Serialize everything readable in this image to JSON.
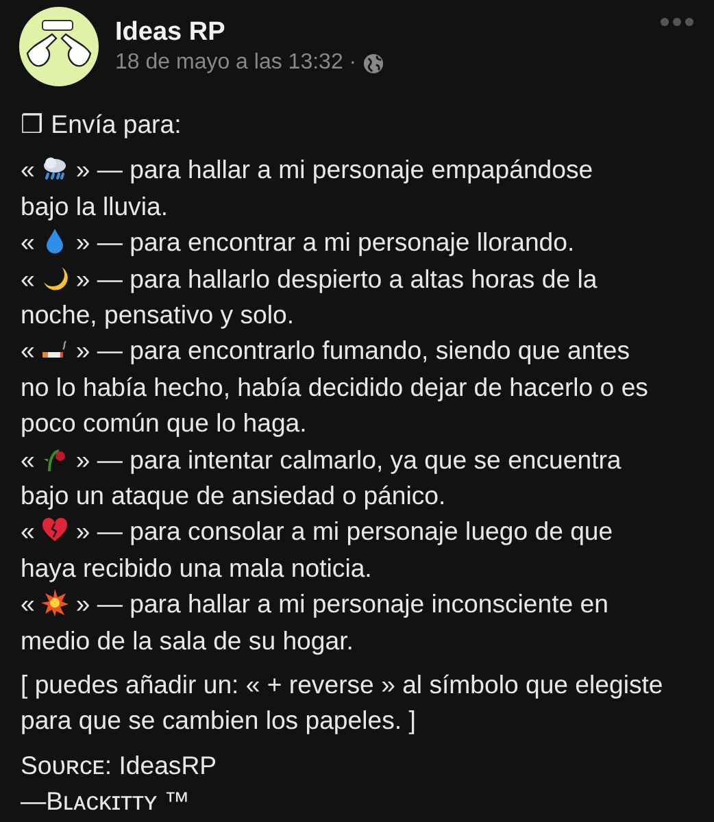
{
  "post": {
    "author": "Ideas RP",
    "timestamp": "18 de mayo a las 13:32 ·"
  },
  "body": {
    "heading": "❒ Envía para:",
    "entries": [
      {
        "kind": "rain",
        "open": "«",
        "text": "» — para hallar a mi personaje empapándose",
        "more": "bajo la lluvia."
      },
      {
        "kind": "droplet",
        "open": "«",
        "text": "» — para encontrar a mi personaje llorando."
      },
      {
        "kind": "moon",
        "open": "«",
        "text": "» — para hallarlo despierto a altas horas de la",
        "more": "noche, pensativo y solo."
      },
      {
        "kind": "cigarette",
        "open": "«",
        "text": "» — para encontrarlo fumando, siendo que antes",
        "more": "no lo había hecho, había decidido dejar de hacerlo o es poco común que lo haga."
      },
      {
        "kind": "rose",
        "open": "«",
        "text": "» — para intentar calmarlo, ya que se encuentra",
        "more": "bajo un ataque de ansiedad o pánico."
      },
      {
        "kind": "heart",
        "open": "«",
        "text": "» — para consolar a mi personaje luego de que",
        "more": "haya recibido una mala noticia."
      },
      {
        "kind": "collision",
        "open": "«",
        "text": "» — para hallar a mi personaje inconsciente en",
        "more": "medio de la sala de su hogar."
      }
    ],
    "note": "[ puedes añadir un: « + reverse » al símbolo que elegiste para que se cambien los papeles. ]",
    "source": "Sᴏᴜʀᴄᴇ: IdeasRP",
    "signature": "—Bʟᴀᴄᴋɪᴛᴛʏ ™"
  }
}
